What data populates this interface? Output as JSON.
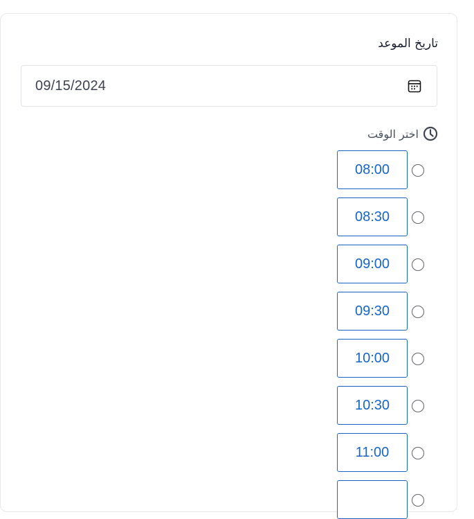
{
  "form": {
    "date_label": "تاريخ الموعد",
    "date_value": "09/15/2024",
    "time_label": "اختر الوقت"
  },
  "time_slots": [
    {
      "label": "08:00",
      "selected": false
    },
    {
      "label": "08:30",
      "selected": false
    },
    {
      "label": "09:00",
      "selected": false
    },
    {
      "label": "09:30",
      "selected": false
    },
    {
      "label": "10:00",
      "selected": false
    },
    {
      "label": "10:30",
      "selected": false
    },
    {
      "label": "11:00",
      "selected": false
    },
    {
      "label": "",
      "selected": false
    }
  ],
  "icons": {
    "calendar": "calendar-icon",
    "clock": "clock-icon"
  },
  "colors": {
    "accent": "#1565c9",
    "border": "#dfe2e7",
    "text": "#141a2e"
  }
}
